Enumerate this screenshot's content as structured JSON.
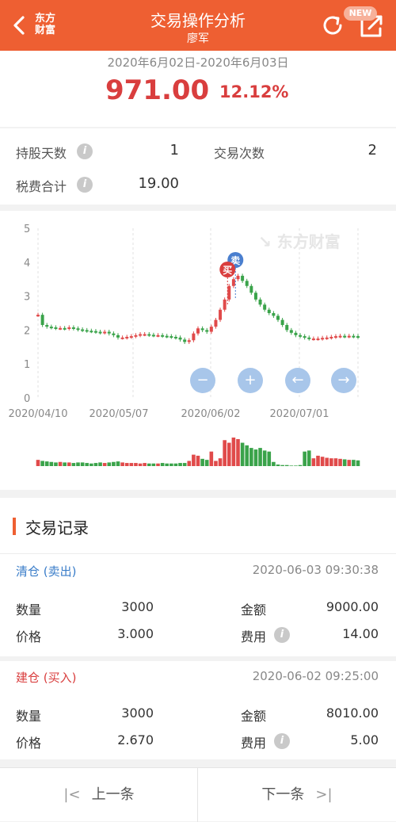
{
  "header": {
    "logo_line1": "东方",
    "logo_line2": "财富",
    "title": "交易操作分析",
    "subtitle": "廖军",
    "new_badge": "NEW",
    "accent": "#ee5f32"
  },
  "summary": {
    "period": "2020年6月02日-2020年6月03日",
    "profit": "971.00",
    "profit_pct": "12.12%"
  },
  "stats": {
    "hold_days_label": "持股天数",
    "hold_days": "1",
    "trade_count_label": "交易次数",
    "trade_count": "2",
    "fees_label": "税费合计",
    "fees": "19.00"
  },
  "chart_data": {
    "type": "candlestick",
    "watermark": "东方财富",
    "y_ticks": [
      "5",
      "4",
      "3",
      "2",
      "1",
      "0"
    ],
    "ylim": [
      0,
      5
    ],
    "x_ticks": [
      "2020/04/10",
      "2020/05/07",
      "2020/06/02",
      "2020/07/01"
    ],
    "markers": [
      {
        "label": "卖",
        "color": "#4a7fcf"
      },
      {
        "label": "买",
        "color": "#d93e3e"
      }
    ],
    "up_color": "#e04a4a",
    "down_color": "#3aa34a",
    "closes": [
      2.45,
      2.15,
      2.1,
      2.08,
      2.06,
      2.06,
      2.05,
      2.08,
      2.05,
      2.02,
      2.0,
      1.98,
      1.97,
      1.95,
      1.93,
      1.95,
      1.9,
      1.85,
      1.78,
      1.78,
      1.8,
      1.82,
      1.85,
      1.88,
      1.88,
      1.86,
      1.85,
      1.85,
      1.83,
      1.82,
      1.8,
      1.78,
      1.72,
      1.65,
      1.7,
      1.9,
      2.05,
      2.0,
      1.95,
      2.1,
      2.3,
      2.6,
      2.9,
      3.3,
      3.5,
      3.6,
      3.45,
      3.3,
      3.1,
      2.9,
      2.75,
      2.6,
      2.5,
      2.42,
      2.3,
      2.15,
      2.0,
      1.92,
      1.85,
      1.82,
      1.78,
      1.75,
      1.75,
      1.75,
      1.77,
      1.78,
      1.8,
      1.82,
      1.83,
      1.82,
      1.83,
      1.82,
      1.8
    ],
    "volumes": [
      12,
      10,
      9,
      8,
      7,
      8,
      7,
      7,
      6,
      7,
      7,
      6,
      5,
      6,
      7,
      6,
      7,
      8,
      9,
      7,
      6,
      6,
      6,
      5,
      6,
      5,
      5,
      5,
      6,
      5,
      5,
      5,
      6,
      6,
      10,
      22,
      20,
      14,
      12,
      28,
      10,
      15,
      50,
      45,
      55,
      52,
      45,
      40,
      35,
      32,
      35,
      30,
      28,
      8,
      3,
      2,
      2,
      1,
      1,
      2,
      28,
      30,
      15,
      20,
      18,
      16,
      15,
      15,
      14,
      13,
      12,
      12,
      11
    ]
  },
  "records": {
    "title": "交易记录",
    "items": [
      {
        "type": "清仓 (卖出)",
        "type_color": "#3a7dc9",
        "time": "2020-06-03 09:30:38",
        "qty_label": "数量",
        "qty": "3000",
        "amount_label": "金额",
        "amount": "9000.00",
        "price_label": "价格",
        "price": "3.000",
        "fee_label": "费用",
        "fee": "14.00"
      },
      {
        "type": "建仓 (买入)",
        "type_color": "#d93e3e",
        "time": "2020-06-02 09:25:00",
        "qty_label": "数量",
        "qty": "3000",
        "amount_label": "金额",
        "amount": "8010.00",
        "price_label": "价格",
        "price": "2.670",
        "fee_label": "费用",
        "fee": "5.00"
      }
    ]
  },
  "nav": {
    "prev": "上一条",
    "next": "下一条"
  }
}
